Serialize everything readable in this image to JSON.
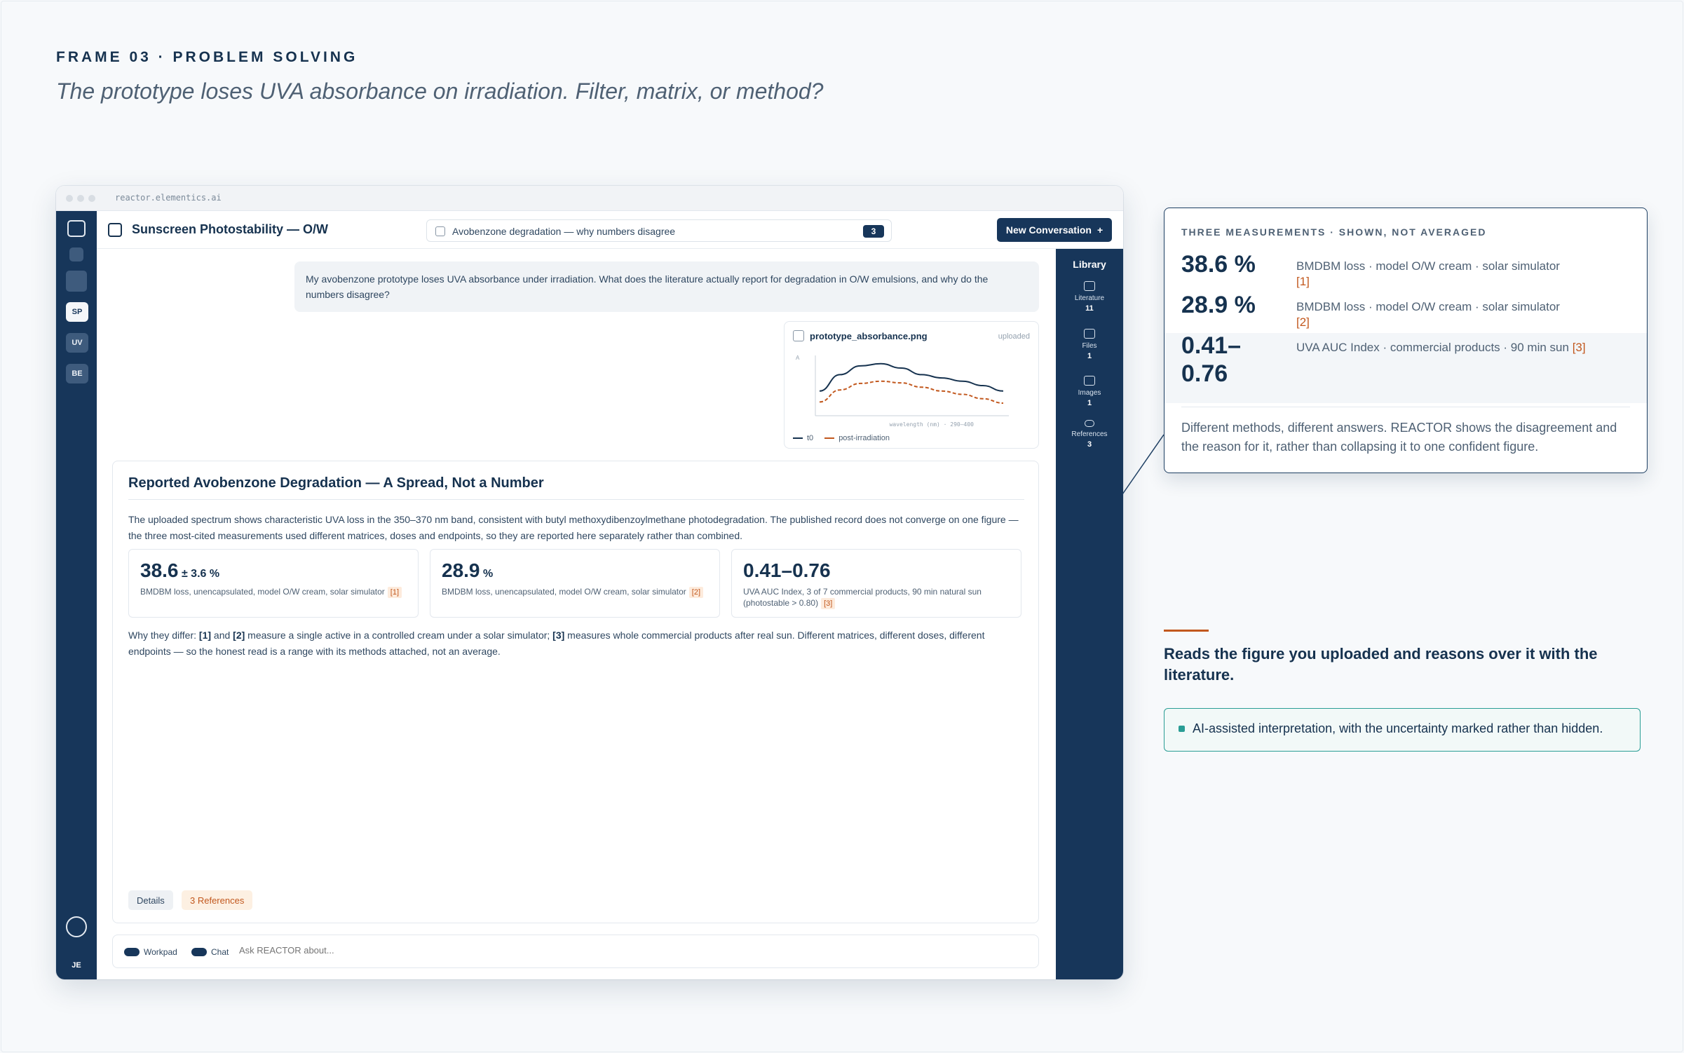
{
  "frame": {
    "eyebrow": "FRAME 03 · PROBLEM SOLVING",
    "headline": "The prototype loses UVA absorbance on irradiation. Filter, matrix, or method?"
  },
  "browser": {
    "url": "reactor.elementics.ai"
  },
  "rail": {
    "items": [
      "SP",
      "UV",
      "BE"
    ],
    "user": "JE"
  },
  "topbar": {
    "title": "Sunscreen Photostability — O/W",
    "topic": "Avobenzone degradation — why numbers disagree",
    "topic_count": "3",
    "new_conversation": "New Conversation",
    "new_icon": "+"
  },
  "user_message": "My avobenzone prototype loses UVA absorbance under irradiation. What does the literature actually report for degradation in O/W emulsions, and why do the numbers disagree?",
  "upload": {
    "filename": "prototype_absorbance.png",
    "tag": "uploaded",
    "y_label": "A",
    "x_label": "wavelength (nm) · 290–400",
    "legend_t0": "t0",
    "legend_post": "post-irradiation"
  },
  "chart_data": {
    "type": "line",
    "series": [
      {
        "name": "t0",
        "values": [
          0.4,
          0.7,
          0.86,
          0.9,
          0.82,
          0.7,
          0.64,
          0.58,
          0.5,
          0.4
        ],
        "color": "#16324f",
        "style": "solid"
      },
      {
        "name": "post-irradiation",
        "values": [
          0.2,
          0.42,
          0.54,
          0.58,
          0.55,
          0.47,
          0.4,
          0.34,
          0.26,
          0.18
        ],
        "color": "#c2581e",
        "style": "dashed"
      }
    ],
    "xlabel": "wavelength (nm) · 290–400",
    "ylabel": "A",
    "grid": false
  },
  "answer": {
    "title": "Reported Avobenzone Degradation — A Spread, Not a Number",
    "intro": "The uploaded spectrum shows characteristic UVA loss in the 350–370 nm band, consistent with butyl methoxydibenzoylmethane photodegradation. The published record does not converge on one figure — the three most-cited measurements used different matrices, doses and endpoints, so they are reported here separately rather than combined.",
    "cards": [
      {
        "value": "38.6",
        "unit": "± 3.6 %",
        "desc": "BMDBM loss, unencapsulated, model O/W cream, solar simulator",
        "ref": "[1]"
      },
      {
        "value": "28.9",
        "unit": "%",
        "desc": "BMDBM loss, unencapsulated, model O/W cream, solar simulator",
        "ref": "[2]"
      },
      {
        "value": "0.41–0.76",
        "unit": "",
        "desc": "UVA AUC Index, 3 of 7 commercial products, 90 min natural sun (photostable > 0.80)",
        "ref": "[3]"
      }
    ],
    "why": {
      "a": "Why they differ: ",
      "r1": "[1]",
      "b": " and ",
      "r2": "[2]",
      "c": " measure a single active in a controlled cream under a solar simulator; ",
      "r3": "[3]",
      "d": " measures whole commercial products after real sun. Different matrices, different doses, different endpoints — so the honest read is a range with its methods attached, not an average."
    },
    "details_chip": "Details",
    "refs_chip": "3 References"
  },
  "composer": {
    "workpad": "Workpad",
    "chat": "Chat",
    "placeholder": "Ask REACTOR about..."
  },
  "library": {
    "title": "Library",
    "items": [
      {
        "label": "Literature",
        "count": "11"
      },
      {
        "label": "Files",
        "count": "1"
      },
      {
        "label": "Images",
        "count": "1"
      },
      {
        "label": "References",
        "count": "3"
      }
    ]
  },
  "callout": {
    "head": "THREE MEASUREMENTS · SHOWN, NOT AVERAGED",
    "rows": [
      {
        "value": "38.6 %",
        "desc": "BMDBM loss · model O/W cream · solar simulator",
        "ref": "[1]"
      },
      {
        "value": "28.9 %",
        "desc": "BMDBM loss · model O/W cream · solar simulator",
        "ref": "[2]"
      },
      {
        "value": "0.41–0.76",
        "desc": "UVA AUC Index · commercial products · 90 min sun",
        "ref": "[3]"
      }
    ],
    "foot": "Different methods, different answers. REACTOR shows the disagreement and the reason for it, rather than collapsing it to one confident figure."
  },
  "side": {
    "reads": "Reads the figure you uploaded and reasons over it with the literature.",
    "note": "AI-assisted interpretation, with the uncertainty marked rather than hidden."
  },
  "colors": {
    "navy": "#17365a",
    "accent": "#c2581e",
    "teal": "#2a9d95"
  }
}
